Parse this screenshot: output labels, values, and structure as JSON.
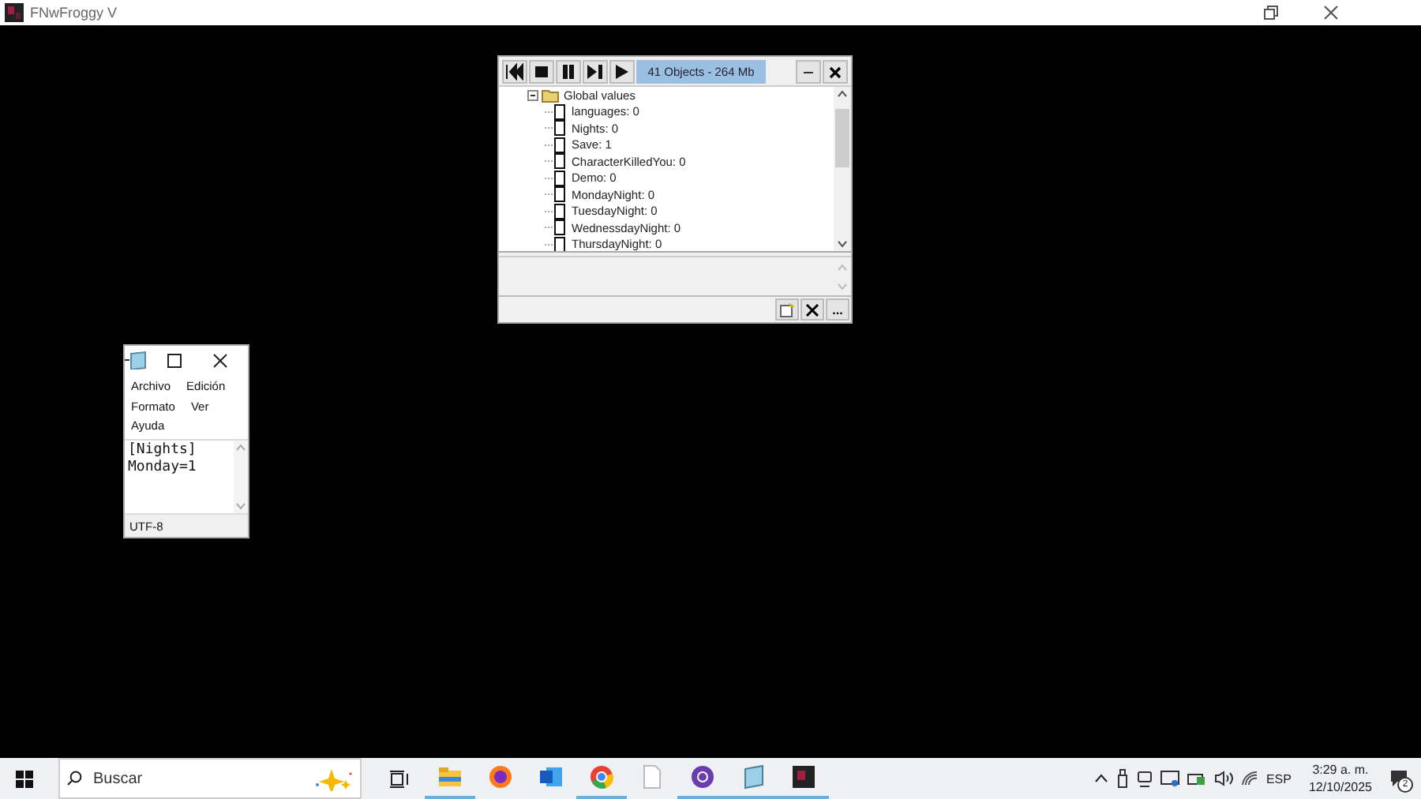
{
  "app_window": {
    "title": "FNwFroggy V"
  },
  "debugger": {
    "status": "41 Objects - 264 Mb",
    "more_button": "...",
    "tree": [
      {
        "label": "Global values",
        "expanded": true,
        "children": [
          {
            "label": "languages: 0"
          },
          {
            "label": "Nights: 0"
          },
          {
            "label": "Save: 1"
          },
          {
            "label": "CharacterKilledYou: 0"
          },
          {
            "label": "Demo: 0"
          },
          {
            "label": "MondayNight: 0"
          },
          {
            "label": "TuesdayNight: 0"
          },
          {
            "label": "WednessdayNight: 0"
          },
          {
            "label": "ThursdayNight: 0"
          }
        ]
      }
    ]
  },
  "notepad": {
    "menu": [
      "Archivo",
      "Edición",
      "Formato",
      "Ver",
      "Ayuda"
    ],
    "lines": [
      "[Nights]",
      "Monday=1"
    ],
    "encoding": "UTF-8"
  },
  "taskbar": {
    "search_placeholder": "Buscar",
    "apps": [
      {
        "kind": "explorer",
        "running": true
      },
      {
        "kind": "firefox",
        "running": false
      },
      {
        "kind": "word",
        "running": false
      },
      {
        "kind": "chrome",
        "running": true
      },
      {
        "kind": "file",
        "running": false
      },
      {
        "kind": "purple",
        "running": true
      },
      {
        "kind": "notepad",
        "running": true
      },
      {
        "kind": "game",
        "running": true
      }
    ],
    "language": "ESP",
    "time": "3:29 a. m.",
    "date": "12/10/2025",
    "notifications": "2"
  }
}
